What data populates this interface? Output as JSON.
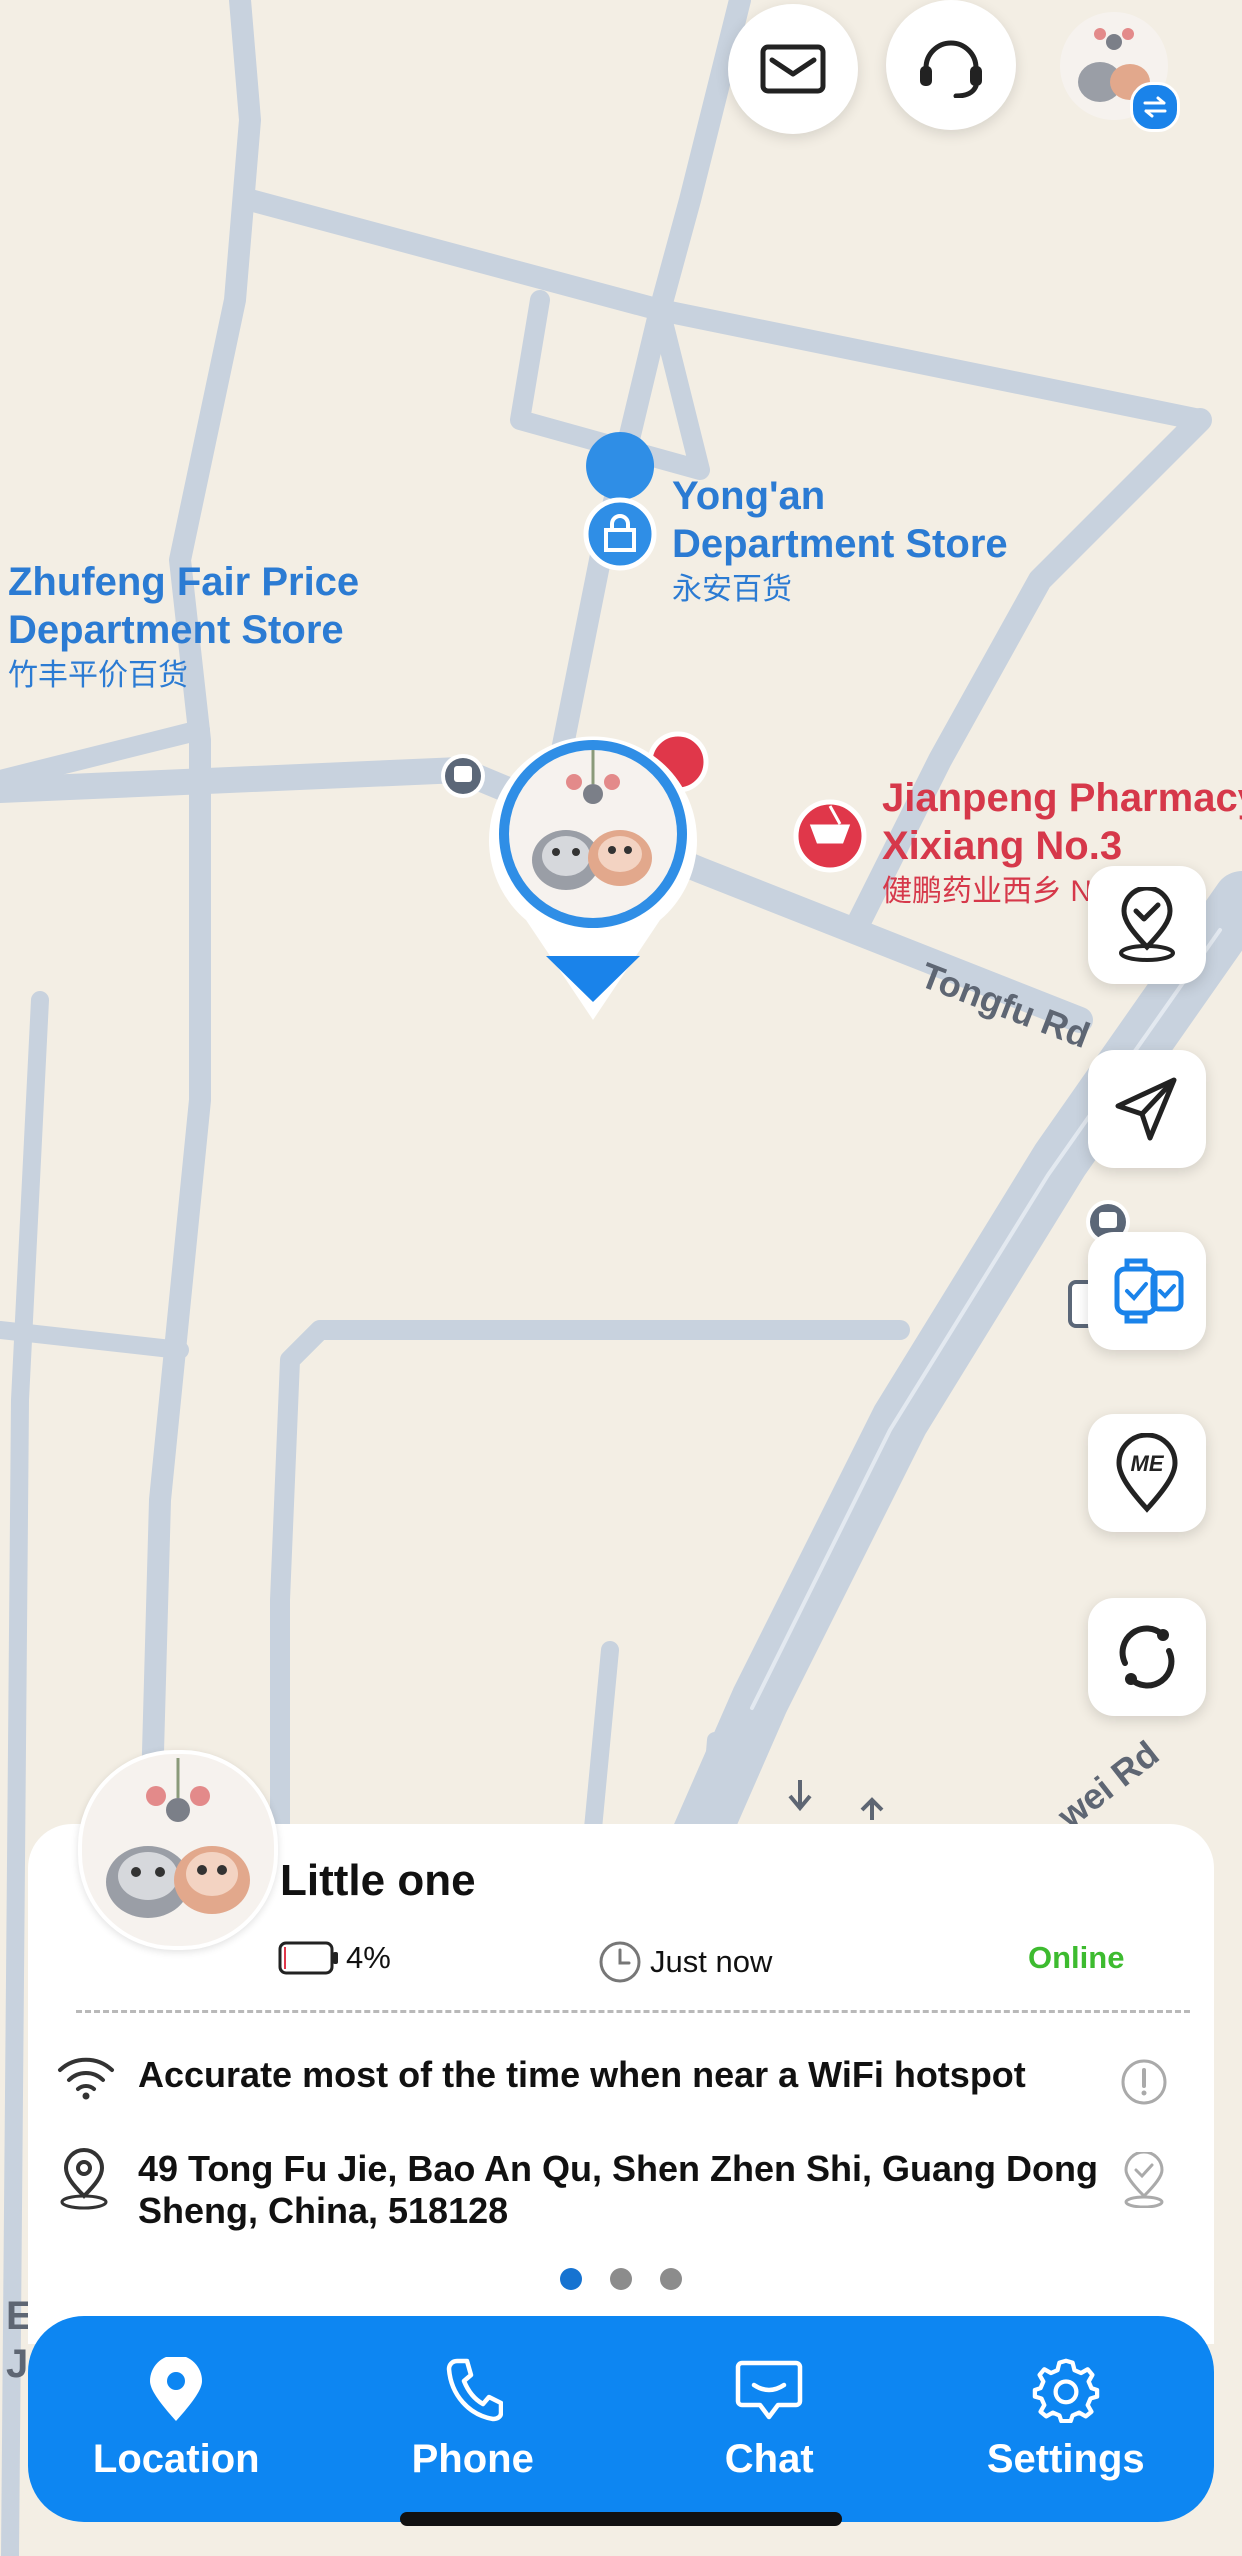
{
  "map": {
    "pois": [
      {
        "name": "Yong'an Department Store",
        "name_lines": [
          "Yong'an",
          "Department Store"
        ],
        "subtitle": "永安百货",
        "icon": "shopping-bag-icon",
        "color": "#2b7bd3"
      },
      {
        "name": "Zhufeng Fair Price Department Store",
        "name_lines": [
          "Zhufeng Fair Price",
          "Department Store"
        ],
        "subtitle": "竹丰平价百货",
        "icon": "shopping-bag-icon",
        "color": "#2b7bd3"
      },
      {
        "name": "Jianpeng Pharmacy Xixiang No.3",
        "name_lines": [
          "Jianpeng Pharmacy",
          "Xixiang No.3"
        ],
        "subtitle": "健鹏药业西乡 N",
        "icon": "pharmacy-mortar-icon",
        "color": "#d6384a"
      }
    ],
    "roads": [
      {
        "name": "Tongfu Rd"
      },
      {
        "name": "wei Rd"
      }
    ],
    "edge_letters": [
      "E",
      "J"
    ]
  },
  "top_bar": {
    "buttons": [
      {
        "name": "messages",
        "icon": "envelope-icon"
      },
      {
        "name": "customer-service",
        "icon": "headset-icon"
      },
      {
        "name": "switch-device",
        "icon": "swap-arrows-icon"
      }
    ]
  },
  "side_actions": [
    {
      "name": "check-in",
      "icon": "location-check-icon"
    },
    {
      "name": "navigate",
      "icon": "paper-plane-icon"
    },
    {
      "name": "watch-status",
      "icon": "smartwatch-icon"
    },
    {
      "name": "my-location",
      "icon": "me-pin-icon",
      "label": "ME"
    },
    {
      "name": "refresh",
      "icon": "refresh-icon"
    }
  ],
  "device": {
    "name": "Little one",
    "battery": "4%",
    "battery_level": 0.04,
    "last_update": "Just now",
    "status": "Online",
    "status_color": "#3dbb2f",
    "accuracy_note": "Accurate most of the time when near a WiFi hotspot",
    "address": "49 Tong Fu Jie, Bao An Qu, Shen Zhen Shi, Guang Dong Sheng, China, 518128"
  },
  "pager": {
    "pages": 3,
    "current": 1
  },
  "tabs": [
    {
      "label": "Location",
      "icon": "location-pin-icon"
    },
    {
      "label": "Phone",
      "icon": "phone-icon"
    },
    {
      "label": "Chat",
      "icon": "chat-bubble-icon"
    },
    {
      "label": "Settings",
      "icon": "gear-icon"
    }
  ],
  "colors": {
    "accent": "#0d86f2",
    "map_background": "#f3eee4",
    "road": "#c9d3df",
    "online": "#3dbb2f"
  }
}
